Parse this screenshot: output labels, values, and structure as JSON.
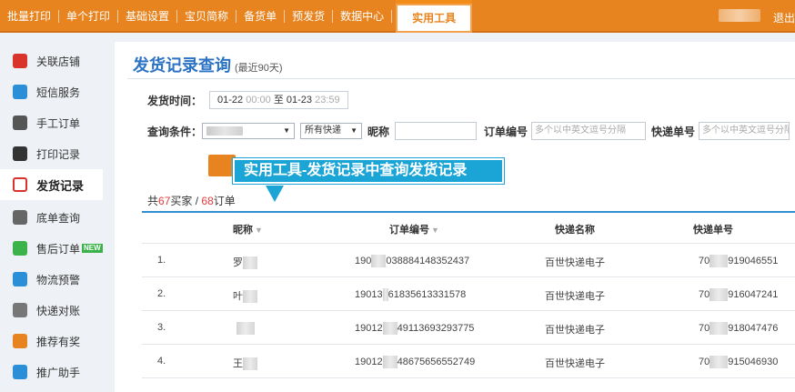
{
  "topnav": {
    "items": [
      "批量打印",
      "单个打印",
      "基础设置",
      "宝贝简称",
      "备货单",
      "预发货",
      "数据中心"
    ],
    "active": "实用工具",
    "logout": "退出"
  },
  "sidebar": {
    "items": [
      {
        "label": "关联店铺",
        "icon": "dice-icon",
        "color": "#d9342b"
      },
      {
        "label": "短信服务",
        "icon": "message-icon",
        "color": "#2a8fd6"
      },
      {
        "label": "手工订单",
        "icon": "printer-icon",
        "color": "#555555"
      },
      {
        "label": "打印记录",
        "icon": "print-record-icon",
        "color": "#333333"
      },
      {
        "label": "发货记录",
        "icon": "shipping-record-icon",
        "color": "#d9342b"
      },
      {
        "label": "底单查询",
        "icon": "list-icon",
        "color": "#555555"
      },
      {
        "label": "售后订单",
        "icon": "after-sale-icon",
        "color": "#3bb34a",
        "badge": "NEW"
      },
      {
        "label": "物流预警",
        "icon": "logistics-icon",
        "color": "#2a8fd6"
      },
      {
        "label": "快递对账",
        "icon": "ledger-icon",
        "color": "#555555"
      },
      {
        "label": "推荐有奖",
        "icon": "gift-icon",
        "color": "#e8841f"
      },
      {
        "label": "推广助手",
        "icon": "chart-icon",
        "color": "#2a8fd6"
      }
    ],
    "active_index": 4
  },
  "main": {
    "title": "发货记录查询",
    "subtitle": "(最近90天)",
    "time_label": "发货时间：",
    "date_from": "01-22",
    "time_from": "00:00",
    "date_sep": "至",
    "date_to": "01-23",
    "time_to": "23:59",
    "query_label": "查询条件：",
    "express_select": "所有快递",
    "nickname_label": "昵称",
    "order_label": "订单编号",
    "order_placeholder": "多个以中英文逗号分隔",
    "tracking_label": "快递单号",
    "tracking_placeholder": "多个以中英文逗号分隔",
    "callout": "实用工具-发货记录中查询发货记录",
    "summary": {
      "prefix": "共",
      "buyers": "67",
      "buyers_unit": "买家 / ",
      "orders": "68",
      "orders_unit": "订单"
    }
  },
  "table": {
    "headers": [
      "昵称",
      "订单编号",
      "快递名称",
      "快递单号"
    ],
    "rows": [
      {
        "idx": "1.",
        "nick": "罗",
        "order_a": "190",
        "order_b": "038884148352437",
        "express": "百世快递电子",
        "track_a": "70",
        "track_b": "919046551"
      },
      {
        "idx": "2.",
        "nick": "叶",
        "order_a": "19013",
        "order_b": "61835613331578",
        "express": "百世快递电子",
        "track_a": "70",
        "track_b": "916047241"
      },
      {
        "idx": "3.",
        "nick": "",
        "order_a": "19012",
        "order_b": "49113693293775",
        "express": "百世快递电子",
        "track_a": "70",
        "track_b": "918047476"
      },
      {
        "idx": "4.",
        "nick": "王",
        "order_a": "19012",
        "order_b": "48675656552749",
        "express": "百世快递电子",
        "track_a": "70",
        "track_b": "915046930"
      }
    ]
  }
}
